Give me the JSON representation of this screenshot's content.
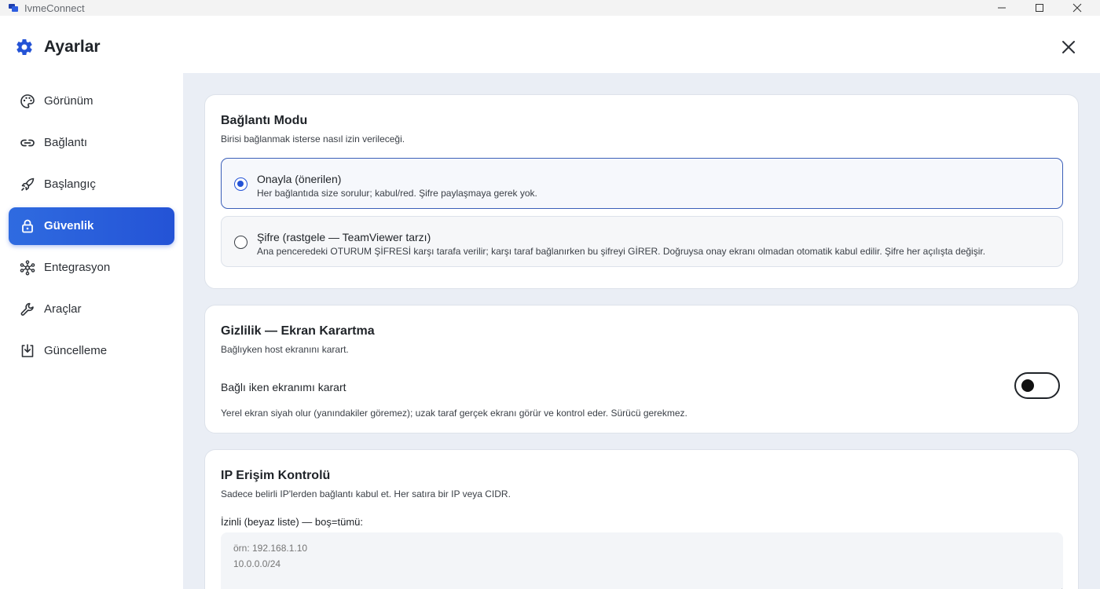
{
  "window": {
    "app_title": "IvmeConnect",
    "minimize_icon": "minimize-icon",
    "maximize_icon": "maximize-icon",
    "close_icon": "close-icon"
  },
  "header": {
    "title": "Ayarlar",
    "icon": "gear-icon",
    "close_icon": "close-icon"
  },
  "sidebar": {
    "active_index": 3,
    "items": [
      {
        "label": "Görünüm",
        "icon": "palette-icon"
      },
      {
        "label": "Bağlantı",
        "icon": "link-icon"
      },
      {
        "label": "Başlangıç",
        "icon": "rocket-icon"
      },
      {
        "label": "Güvenlik",
        "icon": "lock-icon"
      },
      {
        "label": "Entegrasyon",
        "icon": "network-icon"
      },
      {
        "label": "Araçlar",
        "icon": "wrench-icon"
      },
      {
        "label": "Güncelleme",
        "icon": "download-icon"
      }
    ]
  },
  "connection_mode": {
    "title": "Bağlantı Modu",
    "subtitle": "Birisi bağlanmak isterse nasıl izin verileceği.",
    "options": [
      {
        "title": "Onayla (önerilen)",
        "description": "Her bağlantıda size sorulur; kabul/red. Şifre paylaşmaya gerek yok.",
        "selected": true
      },
      {
        "title": "Şifre (rastgele — TeamViewer tarzı)",
        "description": "Ana penceredeki OTURUM ŞİFRESİ karşı tarafa verilir; karşı taraf bağlanırken bu şifreyi GİRER. Doğruysa onay ekranı olmadan otomatik kabul edilir. Şifre her açılışta değişir.",
        "selected": false
      }
    ]
  },
  "privacy": {
    "title": "Gizlilik — Ekran Karartma",
    "subtitle": "Bağlıyken host ekranını karart.",
    "toggle_label": "Bağlı iken ekranımı karart",
    "toggle_on": false,
    "description": "Yerel ekran siyah olur (yanındakiler göremez); uzak taraf gerçek ekranı görür ve kontrol eder. Sürücü gerekmez."
  },
  "ip_access": {
    "title": "IP Erişim Kontrolü",
    "subtitle": "Sadece belirli IP'lerden bağlantı kabul et. Her satıra bir IP veya CIDR.",
    "whitelist_label": "İzinli (beyaz liste) — boş=tümü:",
    "whitelist_placeholder": "örn: 192.168.1.10\n10.0.0.0/24"
  },
  "colors": {
    "accent": "#2453d6",
    "content_bg": "#eaeef5",
    "selected_border": "#3b5fb8"
  }
}
